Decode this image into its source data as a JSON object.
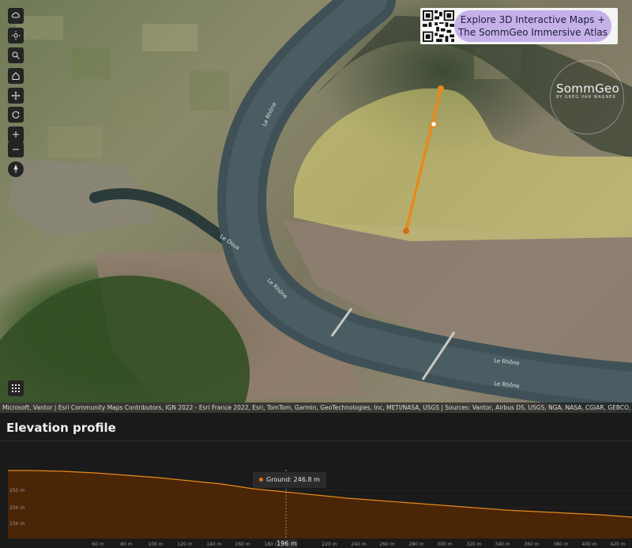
{
  "map": {
    "controls": [
      {
        "name": "weather-icon"
      },
      {
        "name": "daylight-icon"
      },
      {
        "name": "search-icon"
      },
      {
        "name": "home-icon"
      },
      {
        "name": "pan-icon"
      },
      {
        "name": "rotate-icon"
      },
      {
        "name": "zoom-in-icon"
      },
      {
        "name": "zoom-out-icon"
      },
      {
        "name": "compass-icon"
      }
    ],
    "river_labels": [
      "Le Rhône",
      "Le Doux",
      "Le Rhône",
      "Le Rhône",
      "Le Rhône"
    ],
    "promo": {
      "line1": "Explore 3D Interactive Maps +",
      "line2": "The SommGeo Immersive Atlas"
    },
    "brand": {
      "name": "SommGeo",
      "sub": "BY GREG VAN WAGNER"
    },
    "attribution": "Microsoft, Vantor | Esri Community Maps Contributors, IGN 2022 - Esri France 2022, Esri, TomTom, Garmin, GeoTechnologies, Inc, METI/NASA, USGS | Sources: Vantor, Airbus DS, USGS, NGA, NASA, CGIAR, GEBCO, N Robinson, NCEAS, NLS,",
    "colors": {
      "profile_line": "#e8891c",
      "vineyard_overlay": "#e9e27a"
    }
  },
  "elevation": {
    "title": "Elevation profile",
    "tooltip": "Ground: 246.8 m",
    "hover_distance": "196 m",
    "y_ticks": [
      "250 m",
      "200 m",
      "150 m"
    ],
    "x_ticks": [
      "60 m",
      "80 m",
      "100 m",
      "120 m",
      "140 m",
      "160 m",
      "180 m",
      "220 m",
      "240 m",
      "260 m",
      "280 m",
      "300 m",
      "320 m",
      "340 m",
      "360 m",
      "380 m",
      "400 m",
      "420 m"
    ]
  }
}
